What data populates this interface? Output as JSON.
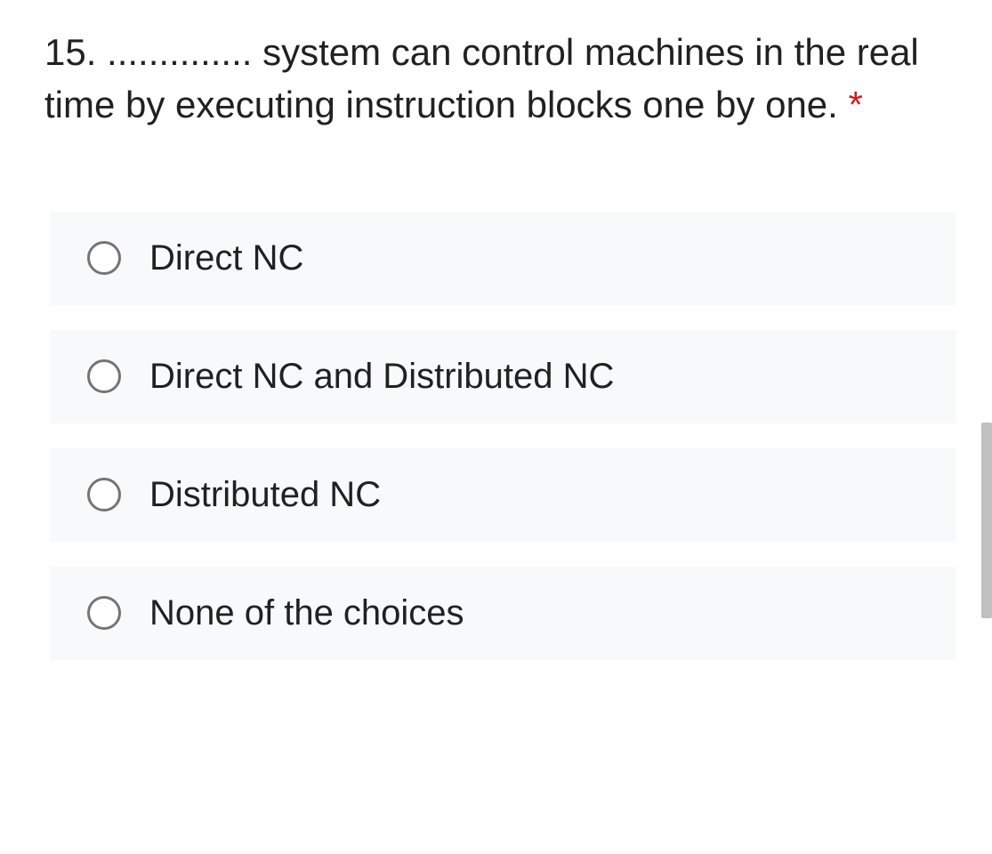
{
  "question": {
    "number": "15.",
    "prompt": "15. .............. system can control machines in the real time by executing instruction blocks one by one.",
    "required": true,
    "asterisk": "*"
  },
  "options": [
    {
      "label": "Direct NC"
    },
    {
      "label": "Direct NC and Distributed NC"
    },
    {
      "label": "Distributed NC"
    },
    {
      "label": "None of the choices"
    }
  ]
}
